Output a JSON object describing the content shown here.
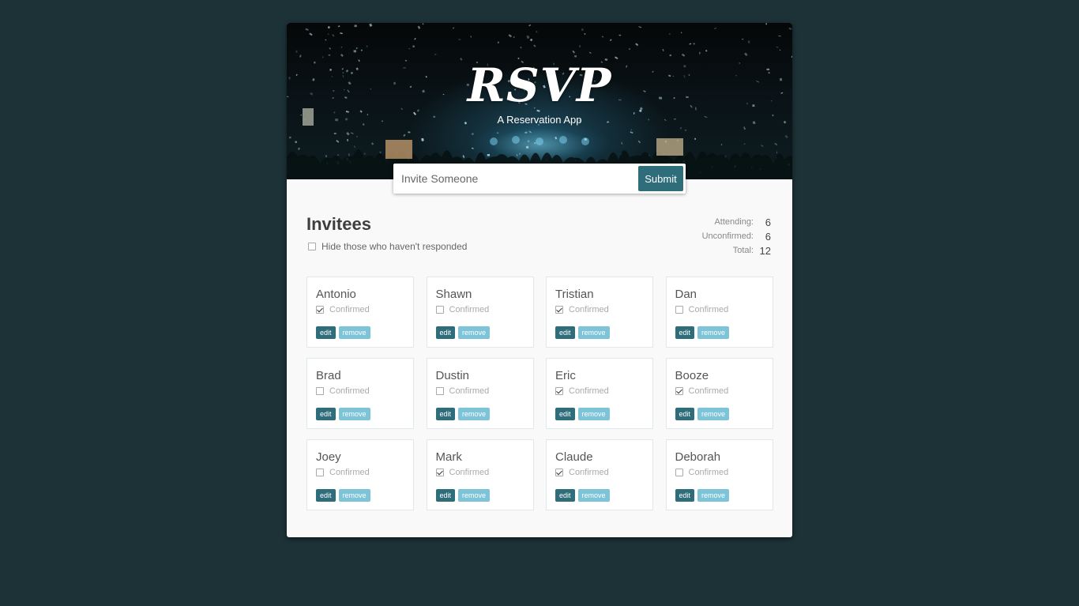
{
  "header": {
    "logo": "RSVP",
    "tagline": "A Reservation App"
  },
  "invite": {
    "placeholder": "Invite Someone",
    "submit_label": "Submit"
  },
  "main": {
    "title": "Invitees",
    "filter_label": "Hide those who haven't responded",
    "filter_checked": false
  },
  "counter": {
    "attending_label": "Attending:",
    "attending": "6",
    "unconfirmed_label": "Unconfirmed:",
    "unconfirmed": "6",
    "total_label": "Total:",
    "total": "12"
  },
  "guest_common": {
    "confirmed_label": "Confirmed",
    "edit_label": "edit",
    "remove_label": "remove"
  },
  "guests": [
    {
      "name": "Antonio",
      "confirmed": true
    },
    {
      "name": "Shawn",
      "confirmed": false
    },
    {
      "name": "Tristian",
      "confirmed": true
    },
    {
      "name": "Dan",
      "confirmed": false
    },
    {
      "name": "Brad",
      "confirmed": false
    },
    {
      "name": "Dustin",
      "confirmed": false
    },
    {
      "name": "Eric",
      "confirmed": true
    },
    {
      "name": "Booze",
      "confirmed": true
    },
    {
      "name": "Joey",
      "confirmed": false
    },
    {
      "name": "Mark",
      "confirmed": true
    },
    {
      "name": "Claude",
      "confirmed": true
    },
    {
      "name": "Deborah",
      "confirmed": false
    }
  ],
  "colors": {
    "background": "#1c3237",
    "primary": "#2f6d7b",
    "secondary": "#7ec4d9"
  }
}
